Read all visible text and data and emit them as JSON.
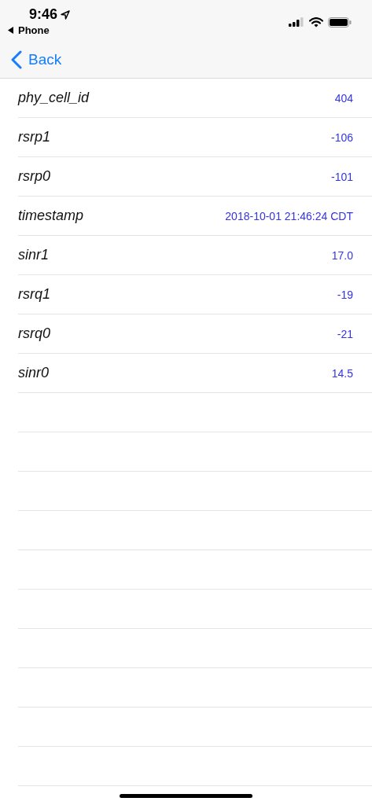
{
  "status_bar": {
    "time": "9:46",
    "back_app": "Phone"
  },
  "nav_bar": {
    "back_label": "Back"
  },
  "rows": [
    {
      "label": "phy_cell_id",
      "value": "404"
    },
    {
      "label": "rsrp1",
      "value": "-106"
    },
    {
      "label": "rsrp0",
      "value": "-101"
    },
    {
      "label": "timestamp",
      "value": "2018-10-01 21:46:24 CDT"
    },
    {
      "label": "sinr1",
      "value": "17.0"
    },
    {
      "label": "rsrq1",
      "value": "-19"
    },
    {
      "label": "rsrq0",
      "value": "-21"
    },
    {
      "label": "sinr0",
      "value": "14.5"
    }
  ]
}
